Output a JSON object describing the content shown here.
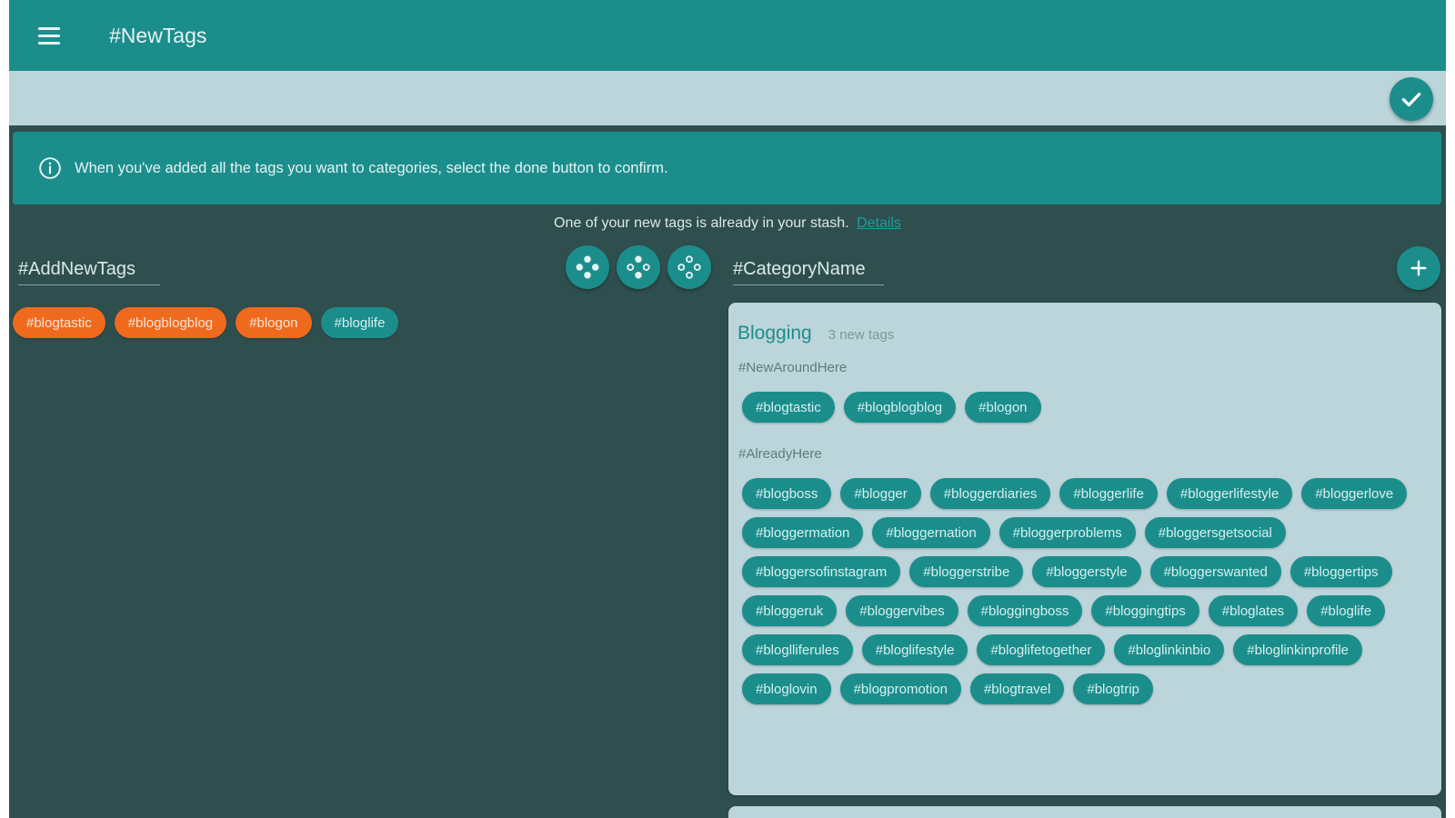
{
  "appbar": {
    "title": "#NewTags"
  },
  "banner": {
    "text": "When you've added all the tags you want to categories, select the done button to confirm."
  },
  "notice": {
    "text": "One of your new tags is already in your stash.",
    "link": "Details"
  },
  "left": {
    "input_placeholder": "#AddNewTags",
    "tags": [
      {
        "label": "#blogtastic",
        "style": "orange"
      },
      {
        "label": "#blogblogblog",
        "style": "orange"
      },
      {
        "label": "#blogon",
        "style": "orange"
      },
      {
        "label": "#bloglife",
        "style": "teal"
      }
    ]
  },
  "right": {
    "input_placeholder": "#CategoryName",
    "category": {
      "title": "Blogging",
      "count": "3 new tags",
      "new_label": "#NewAroundHere",
      "new_tags": [
        "#blogtastic",
        "#blogblogblog",
        "#blogon"
      ],
      "existing_label": "#AlreadyHere",
      "existing_tags": [
        "#blogboss",
        "#blogger",
        "#bloggerdiaries",
        "#bloggerlife",
        "#bloggerlifestyle",
        "#bloggerlove",
        "#bloggermation",
        "#bloggernation",
        "#bloggerproblems",
        "#bloggersgetsocial",
        "#bloggersofinstagram",
        "#bloggerstribe",
        "#bloggerstyle",
        "#bloggerswanted",
        "#bloggertips",
        "#bloggeruk",
        "#bloggervibes",
        "#bloggingboss",
        "#bloggingtips",
        "#bloglates",
        "#bloglife",
        "#bloglliferules",
        "#bloglifestyle",
        "#bloglifetogether",
        "#bloglinkinbio",
        "#bloglinkinprofile",
        "#bloglovin",
        "#blogpromotion",
        "#blogtravel",
        "#blogtrip"
      ]
    }
  },
  "colors": {
    "primary": "#1b8e8c",
    "background": "#2f4f4f",
    "surface": "#bcd5da",
    "accent_orange": "#f06a1e"
  },
  "icons": {
    "menu": "menu-icon",
    "done": "check-icon",
    "info": "info-icon",
    "tools": [
      "move-all-icon",
      "move-selected-icon",
      "move-outline-icon"
    ],
    "add": "plus-icon"
  }
}
